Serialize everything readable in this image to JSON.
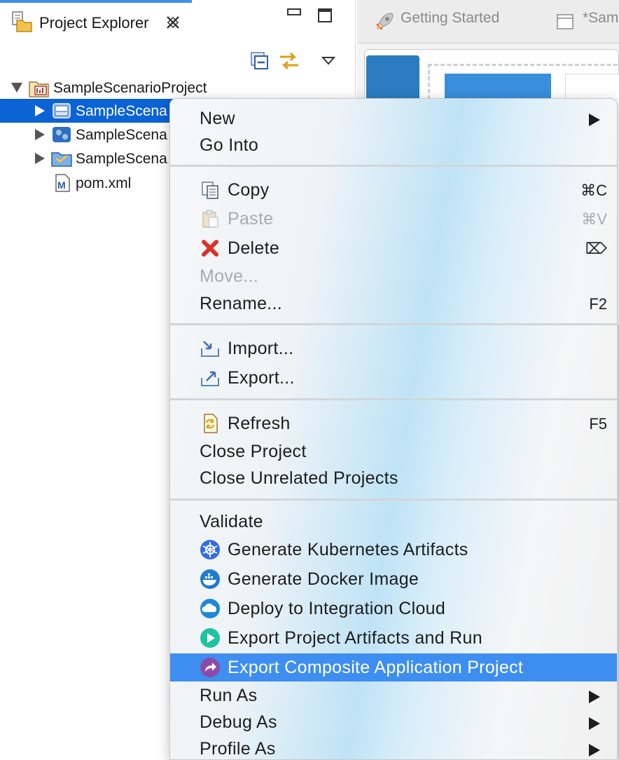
{
  "explorer": {
    "title": "Project Explorer",
    "tree": [
      {
        "label": "SampleScenarioProject",
        "expanded": true
      },
      {
        "label": "SampleScena",
        "selected": true
      },
      {
        "label": "SampleScena"
      },
      {
        "label": "SampleScena"
      },
      {
        "label": "pom.xml"
      }
    ]
  },
  "editor": {
    "tabs": [
      "Getting Started",
      "*Sam"
    ]
  },
  "menu": {
    "items": {
      "new": "New",
      "go_into": "Go Into",
      "copy": "Copy",
      "copy_shortcut": "⌘C",
      "paste": "Paste",
      "paste_shortcut": "⌘V",
      "delete": "Delete",
      "delete_shortcut": "⌦",
      "move": "Move...",
      "rename": "Rename...",
      "rename_shortcut": "F2",
      "import": "Import...",
      "export": "Export...",
      "refresh": "Refresh",
      "refresh_shortcut": "F5",
      "close_project": "Close Project",
      "close_unrelated": "Close Unrelated Projects",
      "validate": "Validate",
      "gen_k8s": "Generate Kubernetes Artifacts",
      "gen_docker": "Generate Docker Image",
      "deploy_cloud": "Deploy to Integration Cloud",
      "export_run": "Export Project Artifacts and Run",
      "export_composite": "Export Composite Application Project",
      "run_as": "Run As",
      "debug_as": "Debug As",
      "profile_as": "Profile As"
    },
    "highlight_color": "#3d8ef0"
  },
  "colors": {
    "selection": "#0b63d4",
    "accent": "#3f8ee8"
  }
}
